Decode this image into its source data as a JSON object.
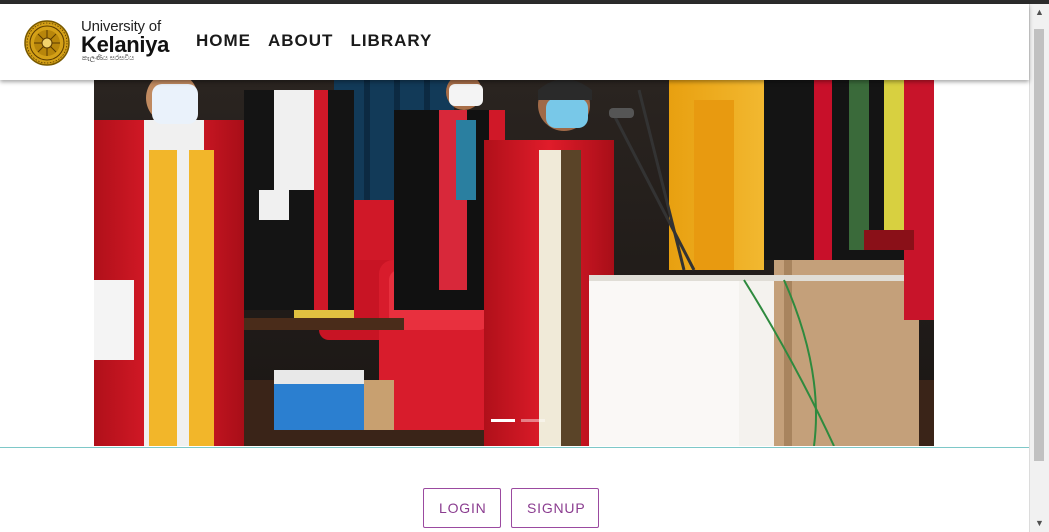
{
  "brand": {
    "line1": "University of",
    "line2": "Kelaniya",
    "line3": "කැලණිය සරසවිය",
    "seal_color": "#d4a017"
  },
  "nav": {
    "items": [
      {
        "label": "HOME"
      },
      {
        "label": "ABOUT"
      },
      {
        "label": "LIBRARY"
      }
    ]
  },
  "carousel": {
    "slides": 2,
    "active": 0
  },
  "auth": {
    "login_label": "LOGIN",
    "signup_label": "SIGNUP",
    "accent": "#8b3d90"
  }
}
